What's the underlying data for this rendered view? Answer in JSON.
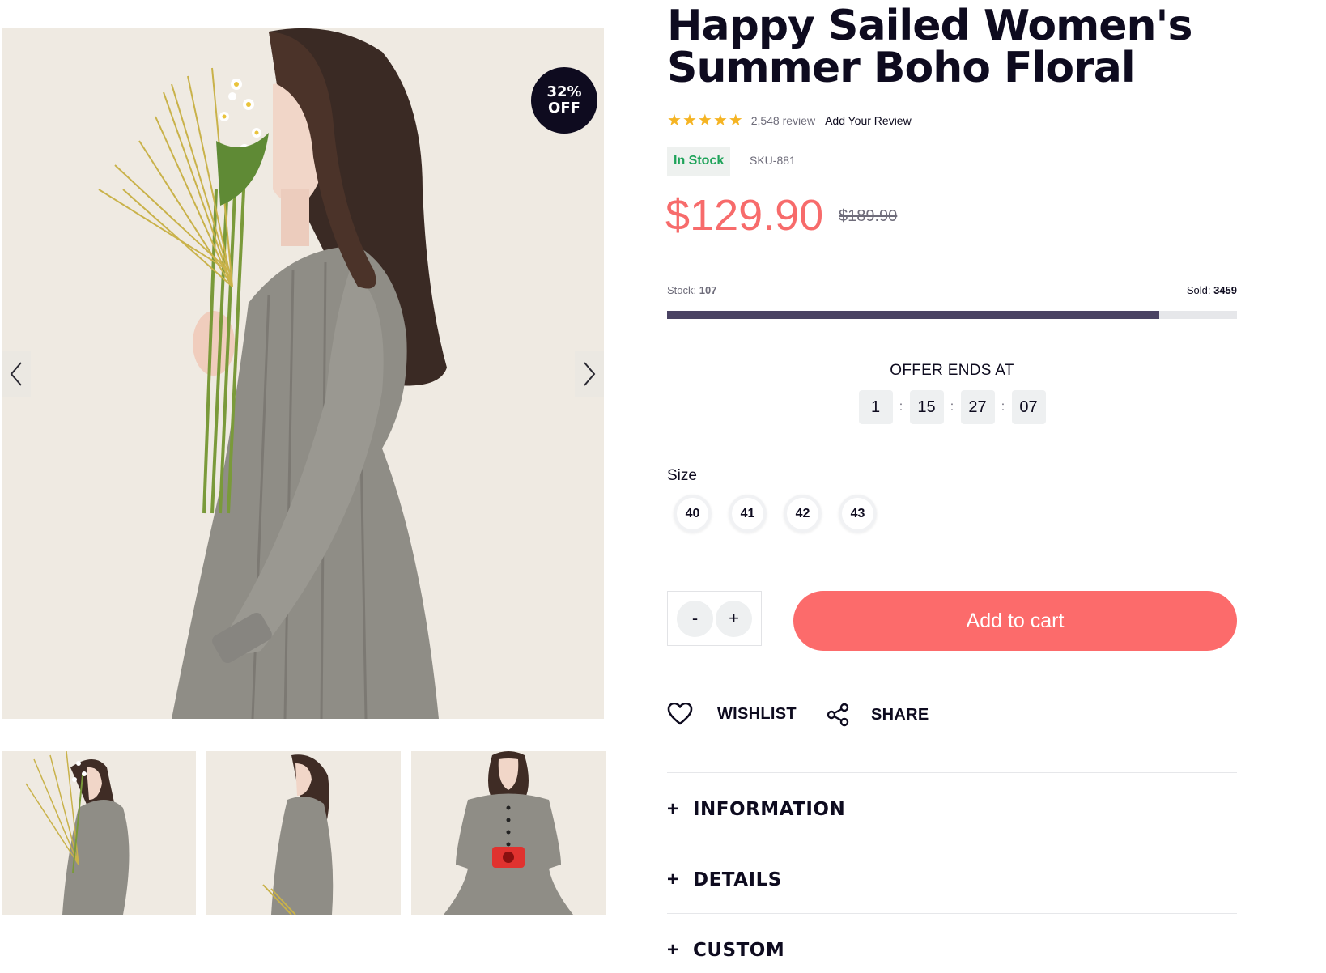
{
  "gallery": {
    "discount_line1": "32%",
    "discount_line2": "OFF",
    "prev_icon": "chevron-left-icon",
    "next_icon": "chevron-right-icon",
    "thumbnails": [
      "thumbnail-1",
      "thumbnail-2",
      "thumbnail-3"
    ]
  },
  "product": {
    "title": "Happy Sailed Women's Summer Boho Floral",
    "rating_stars": 5,
    "review_count": "2,548 review",
    "add_review": "Add Your Review",
    "stock_status": "In Stock",
    "sku": "SKU-881",
    "price": "$129.90",
    "old_price": "$189.90"
  },
  "inventory": {
    "stock_label": "Stock:",
    "stock_value": "107",
    "sold_label": "Sold:",
    "sold_value": "3459",
    "sold_fraction": 0.864
  },
  "offer": {
    "title": "OFFER ENDS AT",
    "days": "1",
    "hours": "15",
    "minutes": "27",
    "seconds": "07",
    "separator": ":"
  },
  "sizes": {
    "label": "Size",
    "options": [
      "40",
      "41",
      "42",
      "43"
    ]
  },
  "cart": {
    "minus": "-",
    "plus": "+",
    "add_to_cart": "Add to cart"
  },
  "actions": {
    "wishlist": "WISHLIST",
    "share": "SHARE"
  },
  "accordion": [
    {
      "plus": "+",
      "label": "INFORMATION"
    },
    {
      "plus": "+",
      "label": "DETAILS"
    },
    {
      "plus": "+",
      "label": "CUSTOM"
    }
  ],
  "colors": {
    "brand_dark": "#0e0b1f",
    "price_red": "#f76b6b",
    "cart_button": "#fc6b6b",
    "in_stock_green": "#1fa35a",
    "star_gold": "#f5b423",
    "progress_fill": "#4a4363",
    "image_background": "#efeae2"
  }
}
